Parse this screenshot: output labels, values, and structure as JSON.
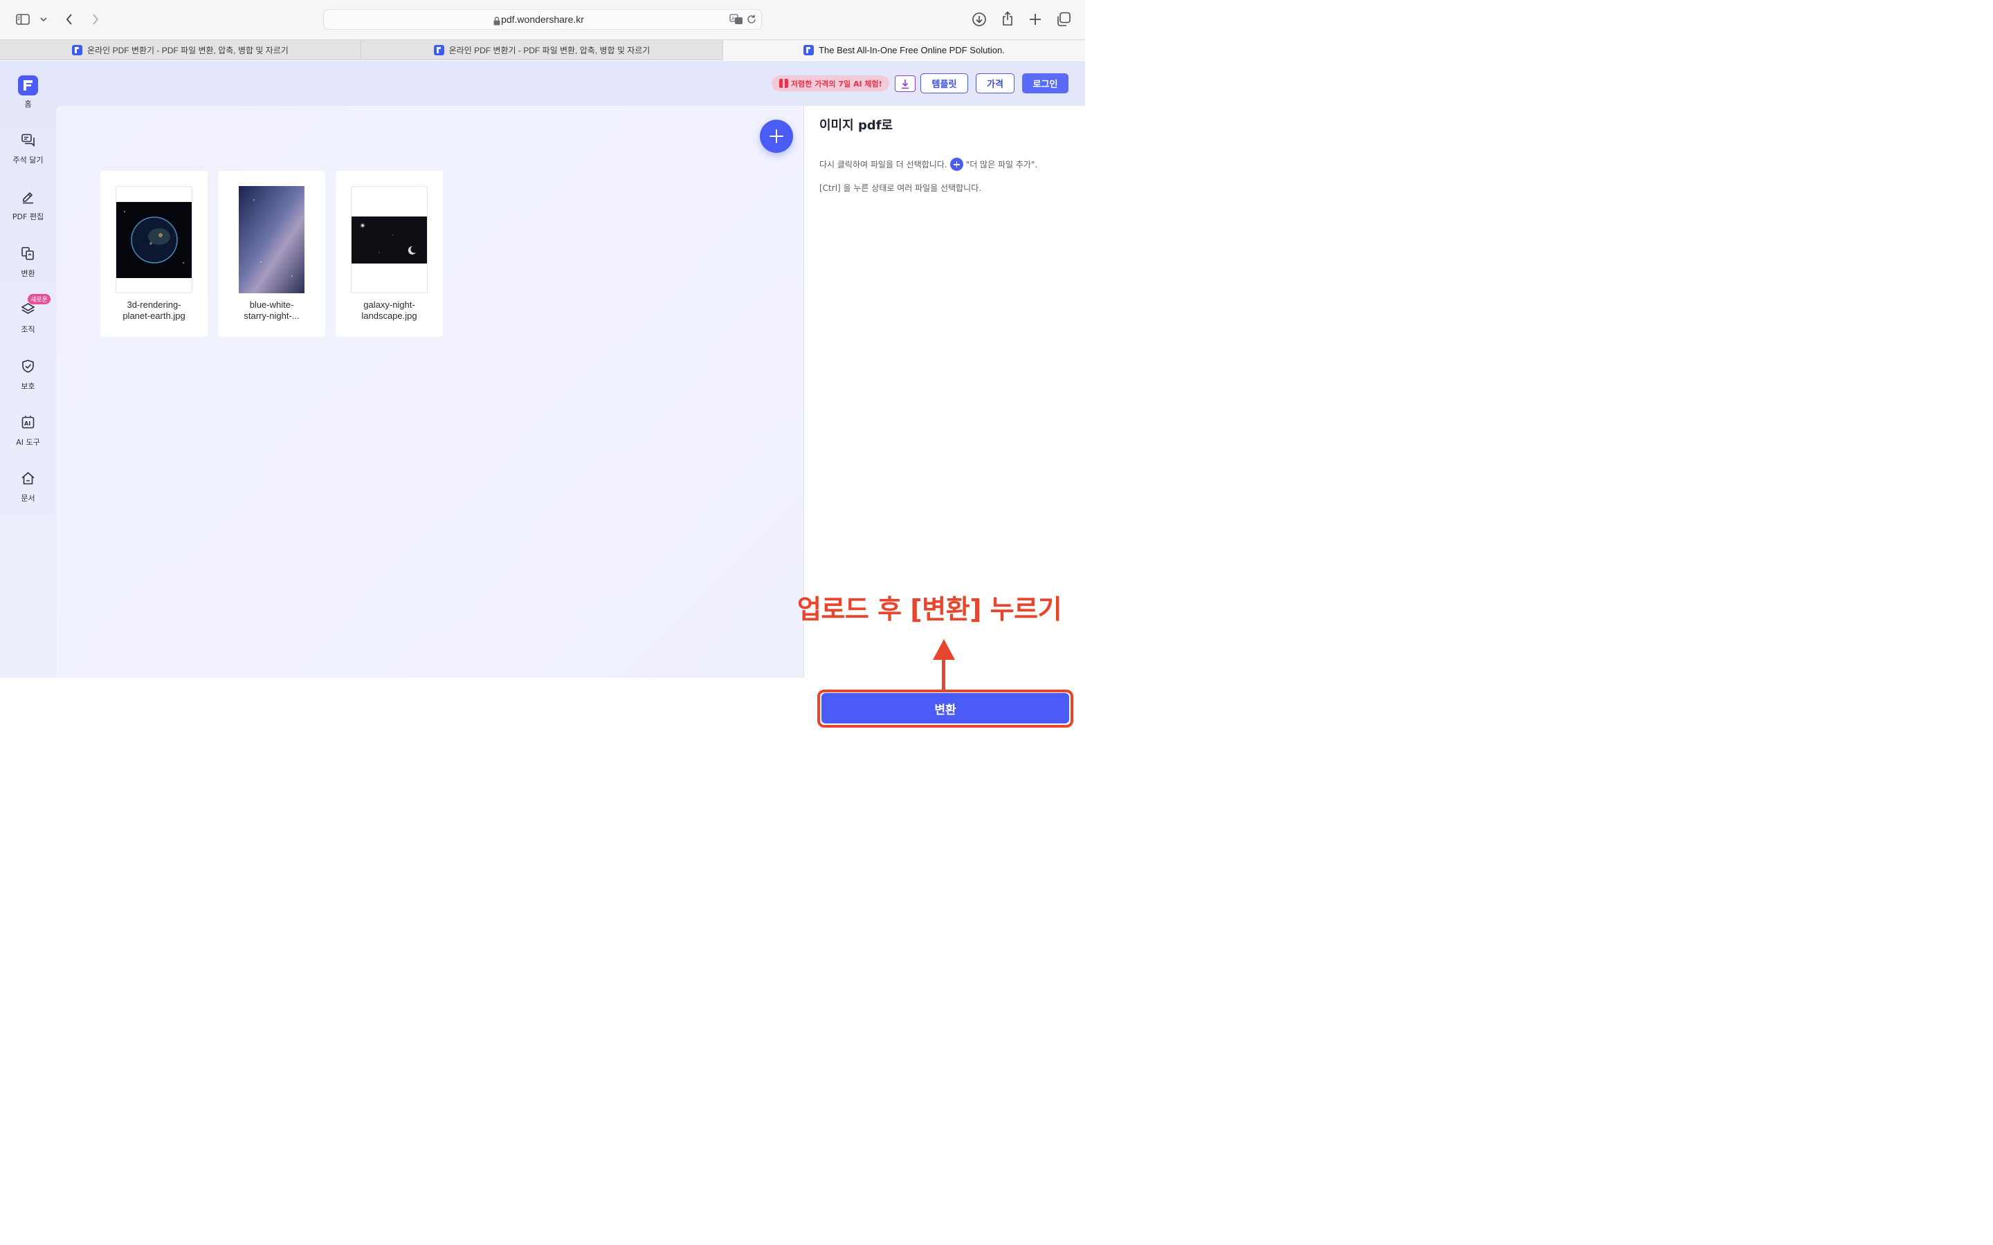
{
  "browser": {
    "url": "pdf.wondershare.kr",
    "tabs": [
      {
        "title": "온라인 PDF 변환기 - PDF 파일 변환, 압축, 병합 및 자르기",
        "active": false
      },
      {
        "title": "온라인 PDF 변환기 - PDF 파일 변환, 압축, 병합 및 자르기",
        "active": false
      },
      {
        "title": "The Best All-In-One Free Online PDF Solution.",
        "active": true
      }
    ]
  },
  "sidebar": {
    "home_label": "홈",
    "items": [
      {
        "label": "주석 달기",
        "icon": "comment-icon"
      },
      {
        "label": "PDF 편집",
        "icon": "edit-pen-icon"
      },
      {
        "label": "변환",
        "icon": "convert-icon"
      },
      {
        "label": "조직",
        "icon": "layers-icon",
        "badge": "새로운"
      },
      {
        "label": "보호",
        "icon": "shield-icon"
      },
      {
        "label": "AI 도구",
        "icon": "ai-tools-icon"
      },
      {
        "label": "문서",
        "icon": "house-icon"
      }
    ]
  },
  "header": {
    "promo": "저렴한 가격의 7일 AI 체험!",
    "template_label": "템플릿",
    "price_label": "가격",
    "login_label": "로그인"
  },
  "files": [
    {
      "name_line1": "3d-rendering-",
      "name_line2": "planet-earth.jpg"
    },
    {
      "name_line1": "blue-white-",
      "name_line2": "starry-night-..."
    },
    {
      "name_line1": "galaxy-night-",
      "name_line2": "landscape.jpg"
    }
  ],
  "panel": {
    "title": "이미지 pdf로",
    "hint1_before": "다시 클릭하여 파일을 더 선택합니다.",
    "hint1_after": "\"더 많은 파일 추가\".",
    "hint2": "[Ctrl] 을 누른 상태로 여러 파일을 선택합니다.",
    "convert_label": "변환"
  },
  "annotation": {
    "text": "업로드 후 [변환] 누르기",
    "color": "#e8452e"
  },
  "colors": {
    "accent": "#4a5cf5",
    "promo_text": "#e8324f"
  }
}
